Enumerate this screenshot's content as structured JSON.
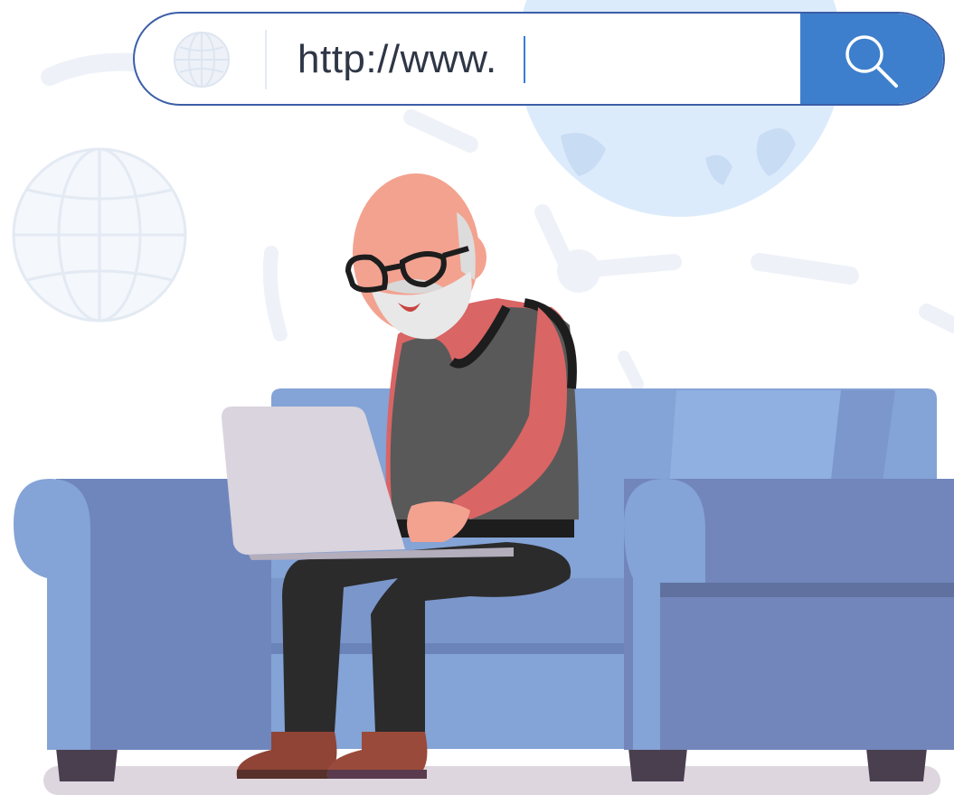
{
  "search_bar": {
    "url_prefix": "http://www.",
    "globe_icon": "globe-icon",
    "search_icon": "magnifier-icon"
  },
  "colors": {
    "bar_border": "#3b5ea8",
    "search_button": "#3d7fcc",
    "sofa": "#84a3d6",
    "sofa_dark": "#6f86bd",
    "vest": "#595959",
    "shirt": "#d96565",
    "skin": "#f3a290",
    "floor_shadow": "#ddd6df"
  }
}
